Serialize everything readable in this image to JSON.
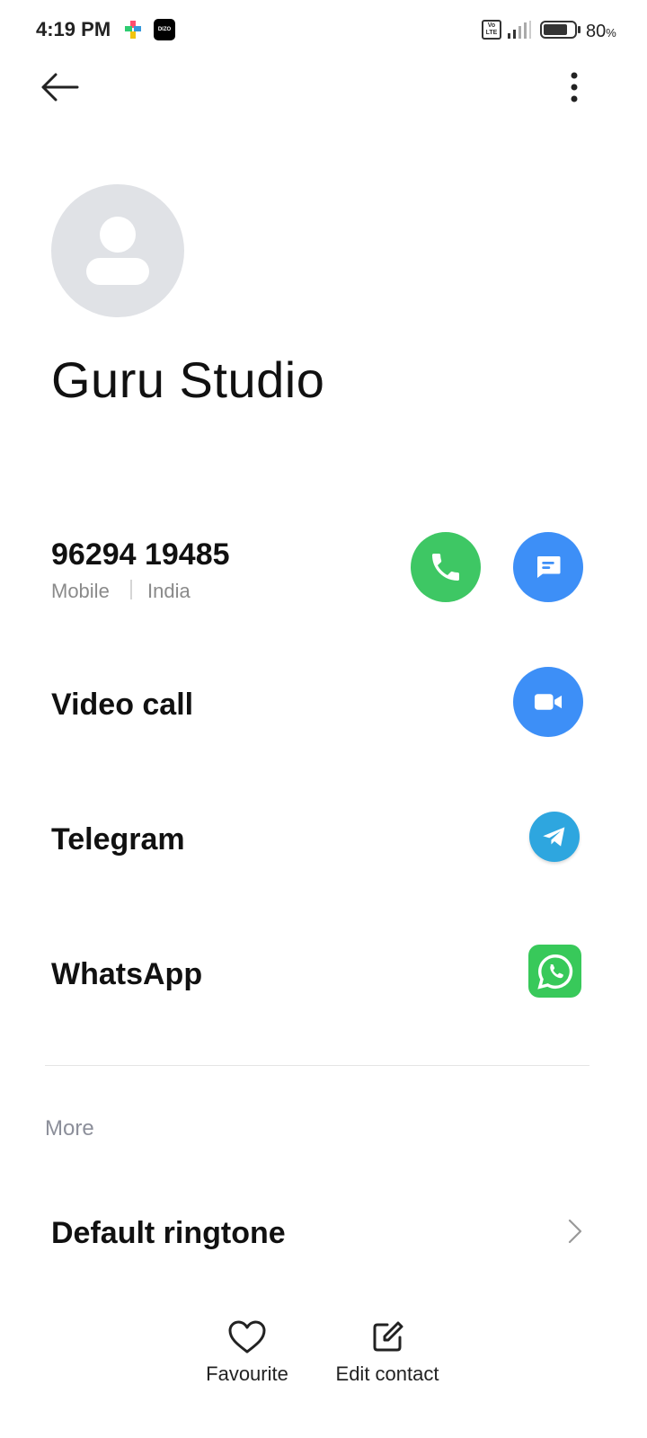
{
  "status_bar": {
    "time": "4:19 PM",
    "app_icon_2_text": "DIZO",
    "volte_text": "Vo LTE",
    "battery_percent": "80",
    "battery_percent_sign": "%",
    "battery_level": 0.8
  },
  "contact": {
    "name": "Guru Studio",
    "phone": {
      "number": "96294 19485",
      "type": "Mobile",
      "country": "India"
    }
  },
  "actions": {
    "video_call_label": "Video call",
    "telegram_label": "Telegram",
    "whatsapp_label": "WhatsApp"
  },
  "more_section": {
    "title": "More",
    "ringtone_label": "Default ringtone"
  },
  "bottom_bar": {
    "favourite_label": "Favourite",
    "edit_contact_label": "Edit contact"
  },
  "colors": {
    "call_green": "#3ec764",
    "message_blue": "#3d8ff7",
    "telegram_blue": "#2ea6df",
    "whatsapp_green": "#38c95a",
    "avatar_gray": "#e0e2e6"
  },
  "icons": {
    "back": "arrow-left-icon",
    "more": "more-vertical-icon",
    "call": "phone-icon",
    "message": "message-icon",
    "video": "video-camera-icon",
    "telegram": "telegram-icon",
    "whatsapp": "whatsapp-icon",
    "ringtone": "chevron-right-icon",
    "favourite": "heart-icon",
    "edit": "edit-icon"
  }
}
